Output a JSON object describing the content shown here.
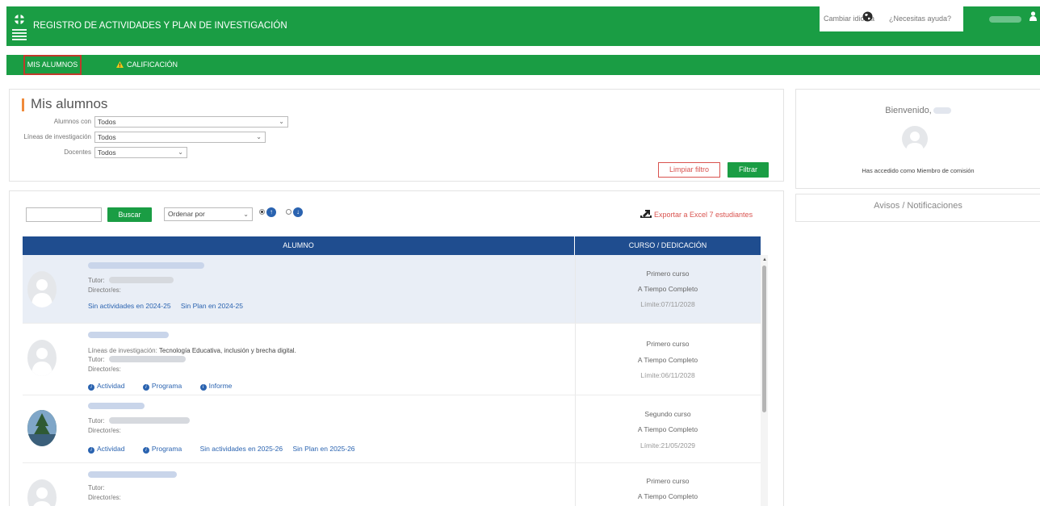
{
  "header": {
    "title": "REGISTRO DE ACTIVIDADES Y PLAN DE INVESTIGACIÓN",
    "change_language": "Cambiar idioma",
    "help": "¿Necesitas ayuda?"
  },
  "nav": {
    "items": [
      {
        "label": "MIS ALUMNOS",
        "active": true
      },
      {
        "label": "CALIFICACIÓN",
        "icon": "warning-icon"
      }
    ]
  },
  "filters": {
    "title": "Mis alumnos",
    "fields": [
      {
        "label": "Alumnos con",
        "value": "Todos"
      },
      {
        "label": "Líneas de investigación",
        "value": "Todos"
      },
      {
        "label": "Docentes",
        "value": "Todos"
      }
    ],
    "clear_label": "Limpiar filtro",
    "filter_label": "Filtrar"
  },
  "toolbar": {
    "search_value": "",
    "search_label": "Buscar",
    "order_value": "Ordenar por",
    "export_label": "Exportar a Excel 7 estudiantes"
  },
  "table": {
    "columns": [
      "ALUMNO",
      "CURSO / DEDICACIÓN"
    ],
    "rows": [
      {
        "lines": null,
        "tutor": "Tutor:",
        "director": "Director/es:",
        "links": [
          "Sin actividades en 2024-25",
          "Sin Plan en 2024-25"
        ],
        "course": "Primero curso",
        "dedication": "A Tiempo Completo",
        "limit": "Límite:07/11/2028"
      },
      {
        "lines_label": "Líneas de investigación:",
        "lines": "Tecnología Educativa, inclusión y brecha digital.",
        "tutor": "Tutor:",
        "director": "Director/es:",
        "links": [
          "Actividad",
          "Programa",
          "Informe"
        ],
        "course": "Primero curso",
        "dedication": "A Tiempo Completo",
        "limit": "Límite:06/11/2028"
      },
      {
        "lines": null,
        "tutor": "Tutor:",
        "director": "Director/es:",
        "links": [
          "Actividad",
          "Programa",
          "Sin actividades en 2025-26",
          "Sin Plan en 2025-26"
        ],
        "course": "Segundo curso",
        "dedication": "A Tiempo Completo",
        "limit": "Límite:21/05/2029"
      },
      {
        "lines": null,
        "tutor": "Tutor:",
        "director": "Director/es:",
        "links": [],
        "course": "Primero curso",
        "dedication": "A Tiempo Completo",
        "limit": ""
      }
    ]
  },
  "sidebar": {
    "welcome": "Bienvenido,",
    "access": "Has accedido como Miembro de comisión",
    "avisos": "Avisos / Notificaciones"
  },
  "colors": {
    "primary_green": "#1a9d44",
    "table_header_blue": "#1f4d8f",
    "link_blue": "#2a63b0",
    "danger_red": "#d9534f",
    "accent_orange": "#f08a3a"
  }
}
